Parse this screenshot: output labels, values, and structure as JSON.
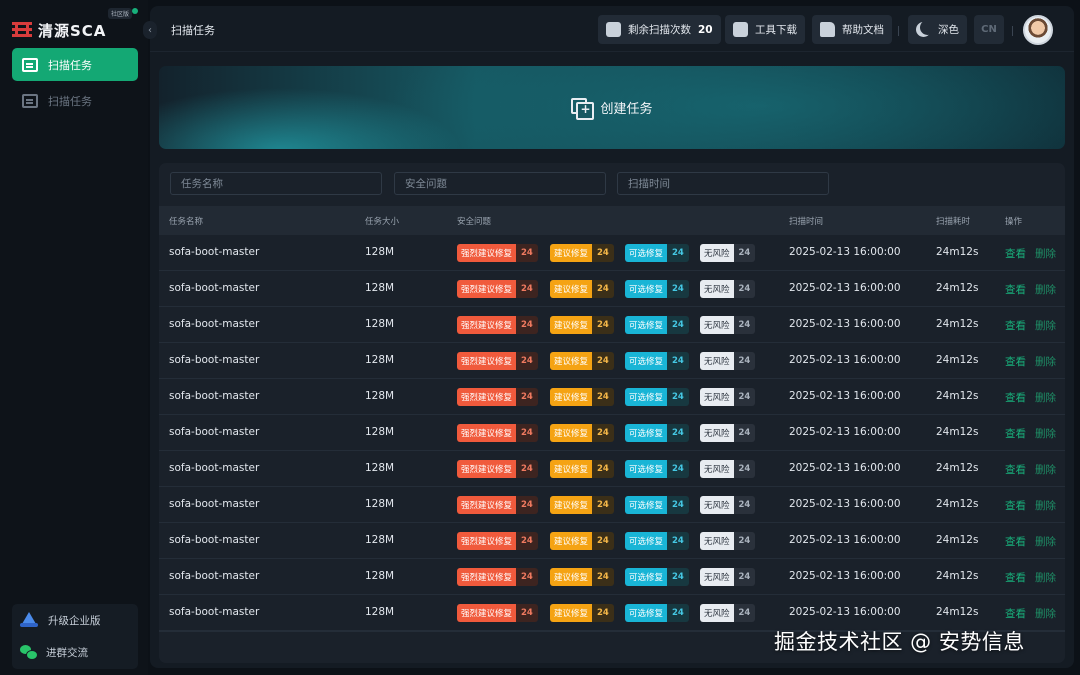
{
  "app": {
    "logo_text": "清源SCA",
    "edition": "社区版"
  },
  "sidebar": {
    "items": [
      {
        "label": "扫描任务",
        "active": true,
        "icon": "scan-task-icon"
      },
      {
        "label": "扫描任务",
        "active": false,
        "icon": "scan-task-icon"
      }
    ],
    "bottom": [
      {
        "label": "升级企业版",
        "icon": "upgrade-icon"
      },
      {
        "label": "进群交流",
        "icon": "wechat-icon"
      }
    ]
  },
  "header": {
    "title": "扫描任务",
    "remaining_label": "剩余扫描次数",
    "remaining_count": "20",
    "tool_download": "工具下载",
    "help_docs": "帮助文档",
    "theme": "深色",
    "lang": "CN"
  },
  "banner": {
    "create_label": "创建任务"
  },
  "filters": {
    "task_name_placeholder": "任务名称",
    "security_placeholder": "安全问题",
    "scan_time_placeholder": "扫描时间"
  },
  "table": {
    "columns": [
      "任务名称",
      "任务大小",
      "安全问题",
      "扫描时间",
      "扫描耗时",
      "操作"
    ],
    "tag_labels": {
      "strong": "强烈建议修复",
      "suggest": "建议修复",
      "optional": "可选修复",
      "none": "无风险"
    },
    "action_view": "查看",
    "action_delete": "删除",
    "rows": [
      {
        "name": "sofa-boot-master",
        "size": "128M",
        "strong": "24",
        "suggest": "24",
        "optional": "24",
        "none": "24",
        "time": "2025-02-13 16:00:00",
        "duration": "24m12s"
      },
      {
        "name": "sofa-boot-master",
        "size": "128M",
        "strong": "24",
        "suggest": "24",
        "optional": "24",
        "none": "24",
        "time": "2025-02-13 16:00:00",
        "duration": "24m12s"
      },
      {
        "name": "sofa-boot-master",
        "size": "128M",
        "strong": "24",
        "suggest": "24",
        "optional": "24",
        "none": "24",
        "time": "2025-02-13 16:00:00",
        "duration": "24m12s"
      },
      {
        "name": "sofa-boot-master",
        "size": "128M",
        "strong": "24",
        "suggest": "24",
        "optional": "24",
        "none": "24",
        "time": "2025-02-13 16:00:00",
        "duration": "24m12s"
      },
      {
        "name": "sofa-boot-master",
        "size": "128M",
        "strong": "24",
        "suggest": "24",
        "optional": "24",
        "none": "24",
        "time": "2025-02-13 16:00:00",
        "duration": "24m12s"
      },
      {
        "name": "sofa-boot-master",
        "size": "128M",
        "strong": "24",
        "suggest": "24",
        "optional": "24",
        "none": "24",
        "time": "2025-02-13 16:00:00",
        "duration": "24m12s"
      },
      {
        "name": "sofa-boot-master",
        "size": "128M",
        "strong": "24",
        "suggest": "24",
        "optional": "24",
        "none": "24",
        "time": "2025-02-13 16:00:00",
        "duration": "24m12s"
      },
      {
        "name": "sofa-boot-master",
        "size": "128M",
        "strong": "24",
        "suggest": "24",
        "optional": "24",
        "none": "24",
        "time": "2025-02-13 16:00:00",
        "duration": "24m12s"
      },
      {
        "name": "sofa-boot-master",
        "size": "128M",
        "strong": "24",
        "suggest": "24",
        "optional": "24",
        "none": "24",
        "time": "2025-02-13 16:00:00",
        "duration": "24m12s"
      },
      {
        "name": "sofa-boot-master",
        "size": "128M",
        "strong": "24",
        "suggest": "24",
        "optional": "24",
        "none": "24",
        "time": "2025-02-13 16:00:00",
        "duration": "24m12s"
      },
      {
        "name": "sofa-boot-master",
        "size": "128M",
        "strong": "24",
        "suggest": "24",
        "optional": "24",
        "none": "24",
        "time": "2025-02-13 16:00:00",
        "duration": "24m12s"
      }
    ]
  },
  "watermark": "掘金技术社区 @ 安势信息",
  "colors": {
    "accent": "#14a874",
    "strong": "#f05a3c",
    "suggest": "#f5a313",
    "optional": "#19b5d6",
    "none": "#e8ecf1"
  }
}
